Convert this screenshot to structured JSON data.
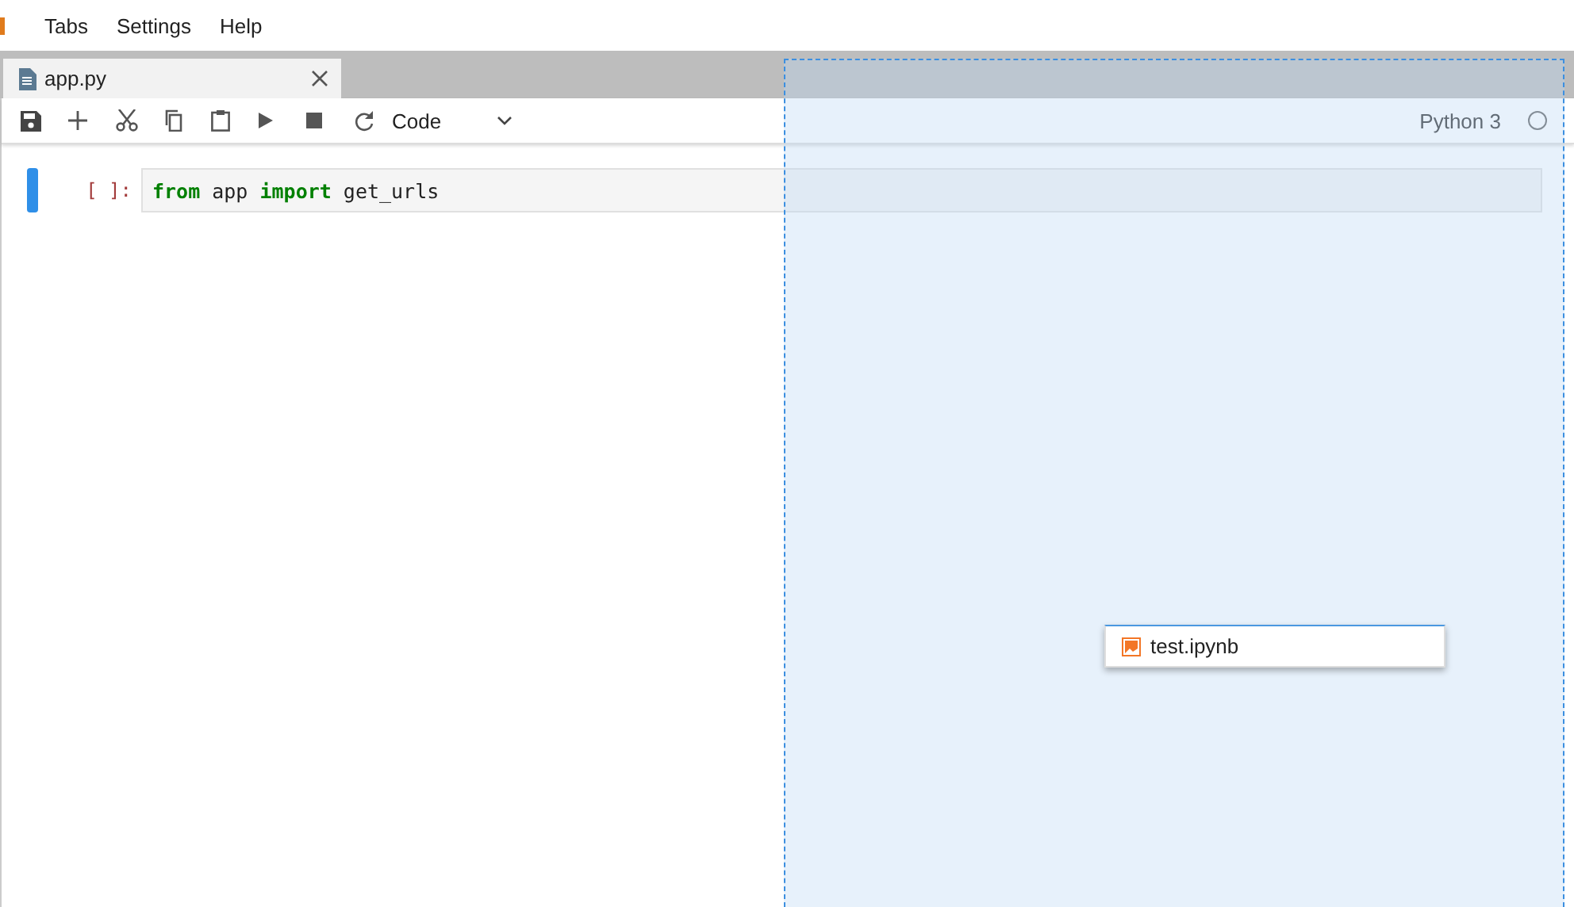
{
  "menu": [
    "Tabs",
    "Settings",
    "Help"
  ],
  "tabs": [
    {
      "label": "app.py",
      "selected": true
    }
  ],
  "toolbar": {
    "cell_type": "Code"
  },
  "kernel": {
    "name": "Python 3",
    "busy": false
  },
  "cells": [
    {
      "prompt": "[ ]:",
      "source": "**from** app **import** get_urls",
      "active": true
    }
  ],
  "drag": {
    "file": "test.ipynb"
  }
}
